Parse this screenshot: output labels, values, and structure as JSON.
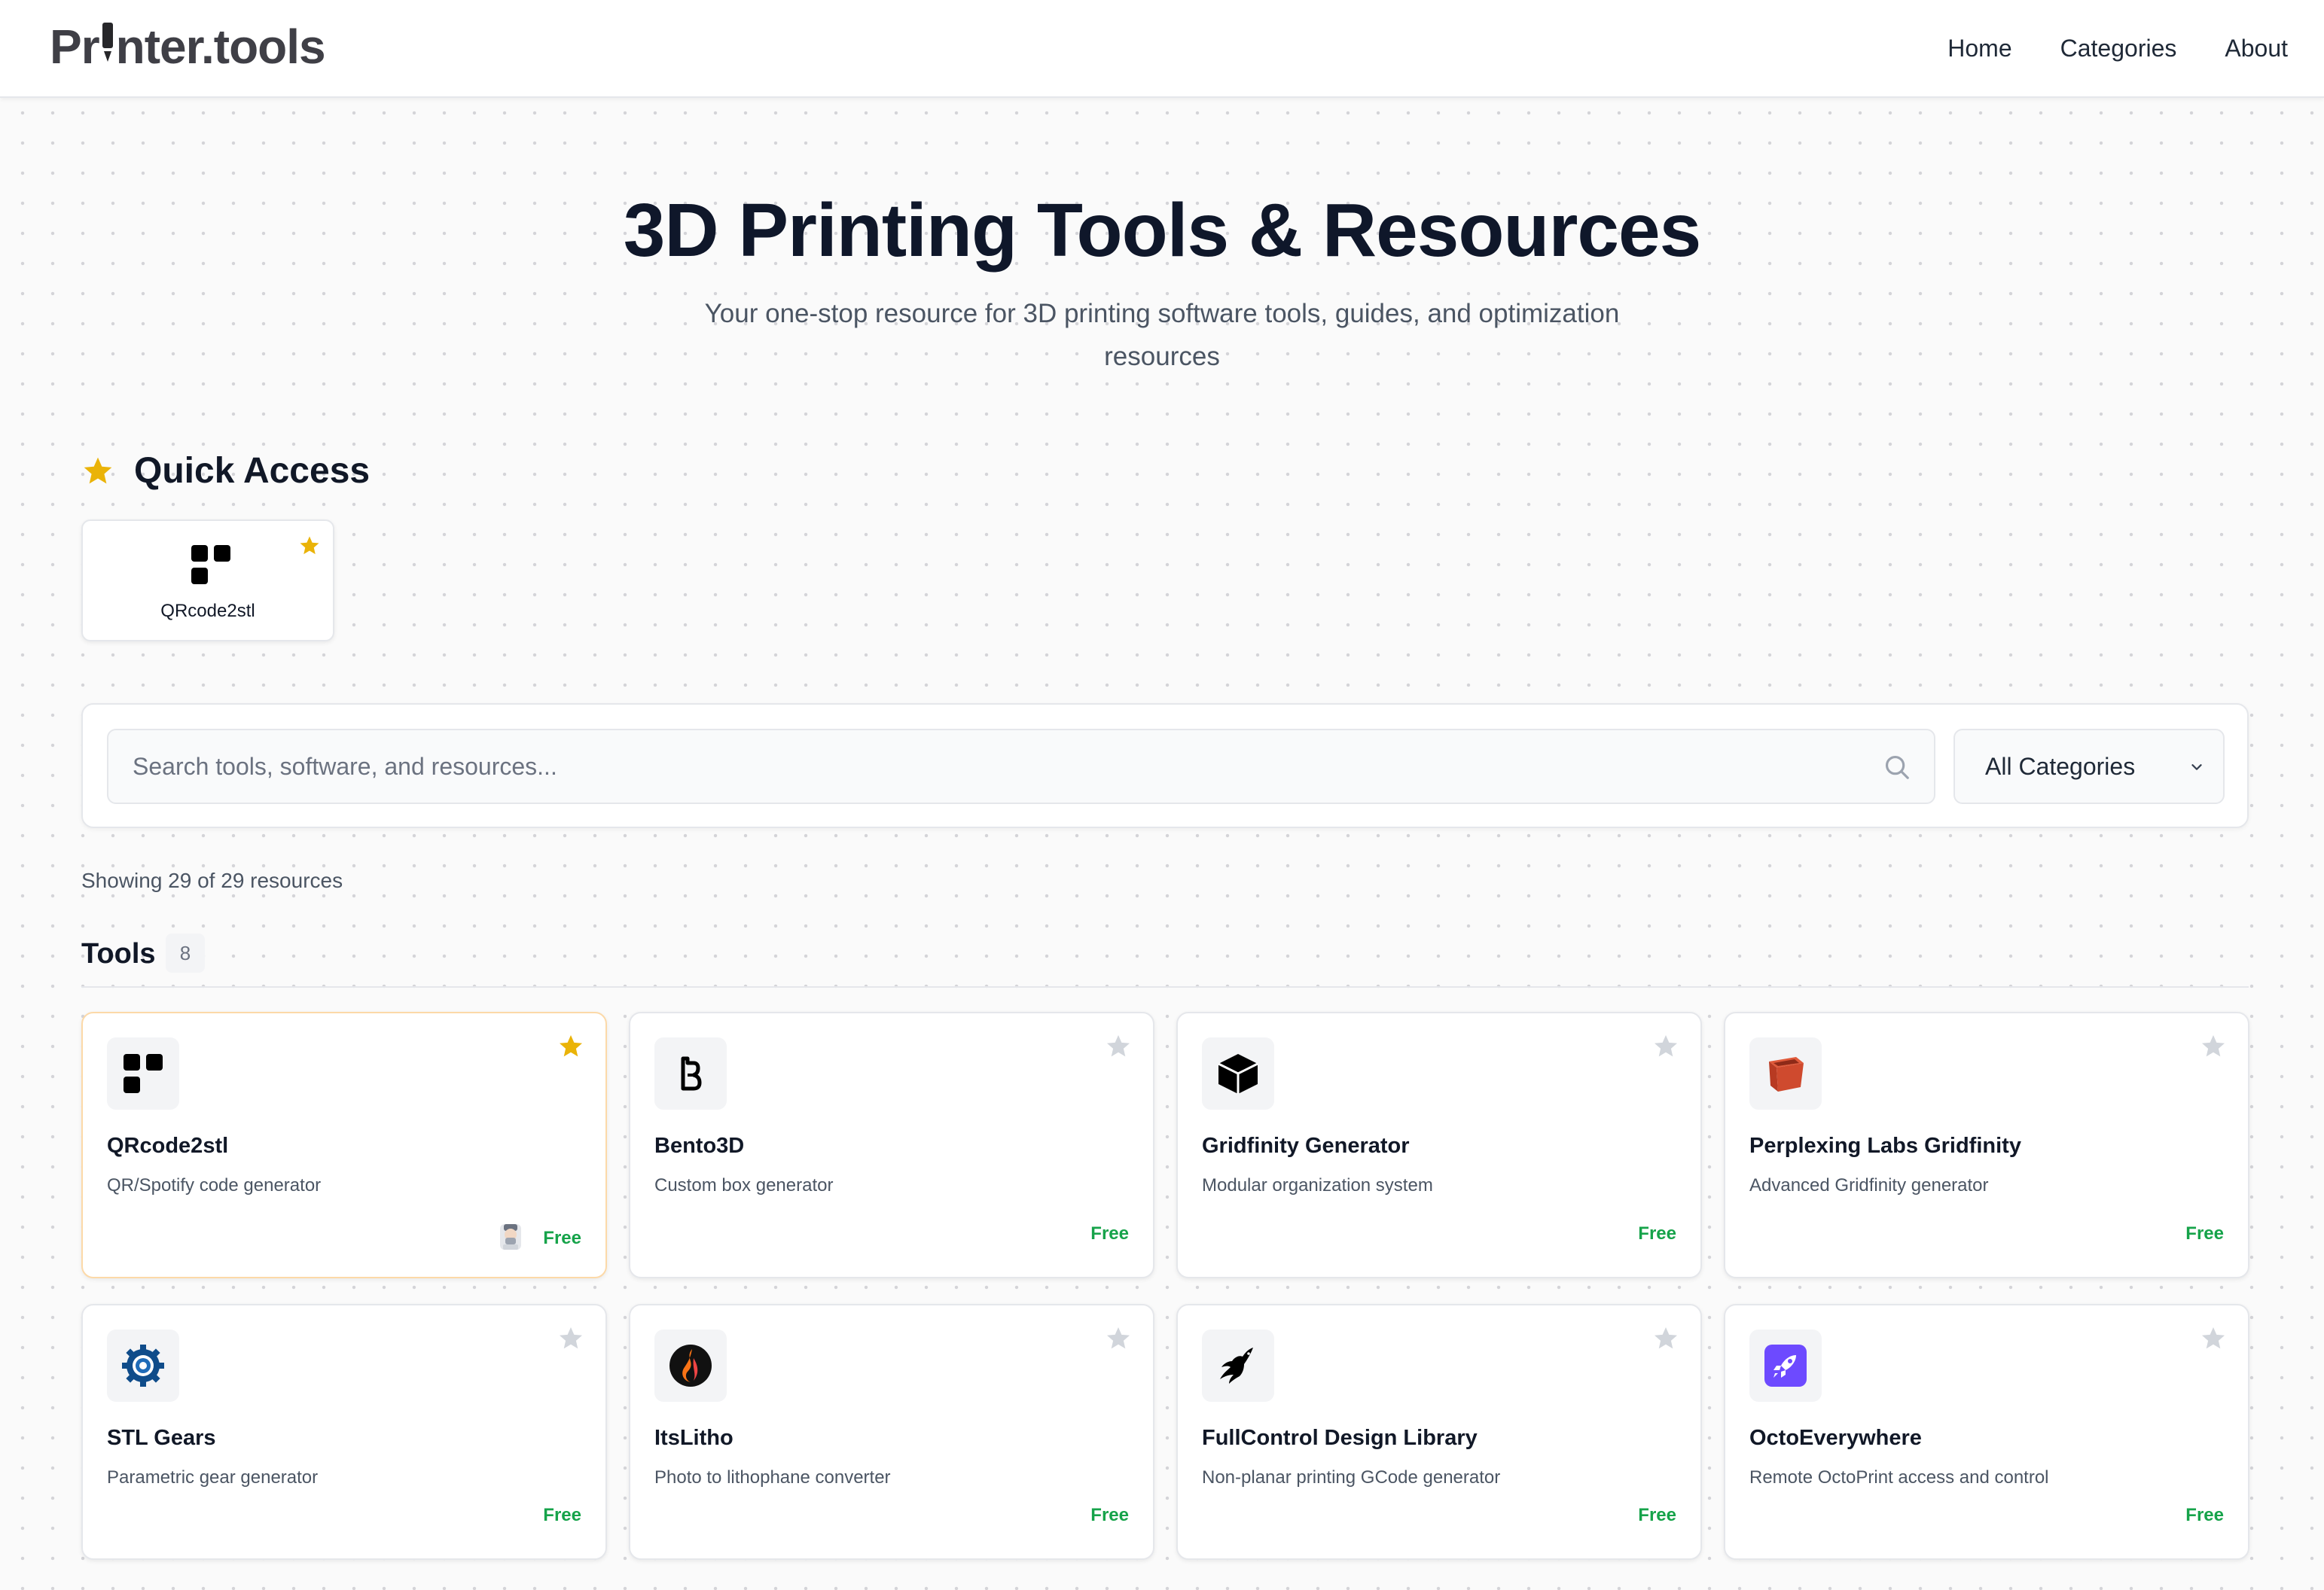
{
  "header": {
    "logo_prefix": "Pr",
    "logo_suffix": "nter.tools",
    "nav": [
      "Home",
      "Categories",
      "About"
    ]
  },
  "hero": {
    "title": "3D Printing Tools & Resources",
    "subtitle": "Your one-stop resource for 3D printing software tools, guides, and optimization resources"
  },
  "quick_access": {
    "title": "Quick Access",
    "items": [
      {
        "label": "QRcode2stl",
        "icon": "qr-blocks-icon"
      }
    ]
  },
  "search": {
    "placeholder": "Search tools, software, and resources...",
    "value": "",
    "category_selected": "All Categories"
  },
  "results": {
    "showing_text": "Showing 29 of 29 resources"
  },
  "section": {
    "title": "Tools",
    "count": "8",
    "cards": [
      {
        "name": "QRcode2stl",
        "desc": "QR/Spotify code generator",
        "price": "Free",
        "icon": "qr-blocks-icon",
        "favorited": true,
        "has_avatar": true
      },
      {
        "name": "Bento3D",
        "desc": "Custom box generator",
        "price": "Free",
        "icon": "bento-b-icon",
        "favorited": false
      },
      {
        "name": "Gridfinity Generator",
        "desc": "Modular organization system",
        "price": "Free",
        "icon": "cube-icon",
        "favorited": false
      },
      {
        "name": "Perplexing Labs Gridfinity",
        "desc": "Advanced Gridfinity generator",
        "price": "Free",
        "icon": "red-bin-icon",
        "favorited": false
      },
      {
        "name": "STL Gears",
        "desc": "Parametric gear generator",
        "price": "Free",
        "icon": "gear-icon",
        "favorited": false
      },
      {
        "name": "ItsLitho",
        "desc": "Photo to lithophane converter",
        "price": "Free",
        "icon": "flame-icon",
        "favorited": false
      },
      {
        "name": "FullControl Design Library",
        "desc": "Non-planar printing GCode generator",
        "price": "Free",
        "icon": "eagle-icon",
        "favorited": false
      },
      {
        "name": "OctoEverywhere",
        "desc": "Remote OctoPrint access and control",
        "price": "Free",
        "icon": "rocket-icon",
        "favorited": false
      }
    ]
  },
  "colors": {
    "accent_star": "#eab308",
    "inactive_star": "#d1d5db",
    "free_green": "#16a34a",
    "fav_border": "#fcd9a8",
    "octo_purple": "#6d4aff"
  }
}
